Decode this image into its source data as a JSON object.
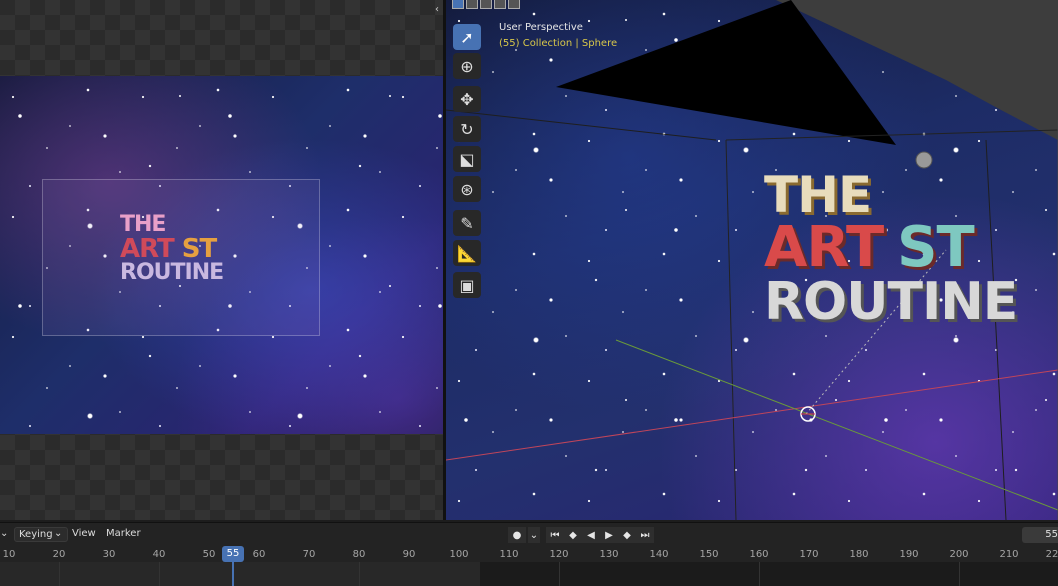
{
  "viewport": {
    "view_label": "User Perspective",
    "collection_label": "(55) Collection | Sphere"
  },
  "render_logo": {
    "line1": "THE",
    "line2": "ART",
    "line2b": "ST",
    "line3": "ROUTINE"
  },
  "timeline": {
    "left_menu": "",
    "keying_label": "Keying",
    "view_label": "View",
    "marker_label": "Marker",
    "current_frame": "55",
    "frame_field": "55",
    "ticks": [
      "10",
      "20",
      "30",
      "40",
      "50",
      "60",
      "70",
      "80",
      "90",
      "100",
      "110",
      "120",
      "130",
      "140",
      "150",
      "160",
      "170",
      "180",
      "190",
      "200",
      "210",
      "22"
    ]
  },
  "playback": {
    "record": "●",
    "jump_start": "⏮",
    "prev_key": "◆",
    "play_reverse": "◀",
    "play": "▶",
    "next_key": "◆",
    "jump_end": "⏭"
  },
  "colors": {
    "accent": "#4772b3",
    "collection_text": "#d8c84a"
  },
  "tools": [
    "select-box-icon",
    "cursor-icon",
    "move-icon",
    "rotate-icon",
    "scale-icon",
    "transform-icon",
    "annotate-icon",
    "measure-icon",
    "add-cube-icon"
  ]
}
